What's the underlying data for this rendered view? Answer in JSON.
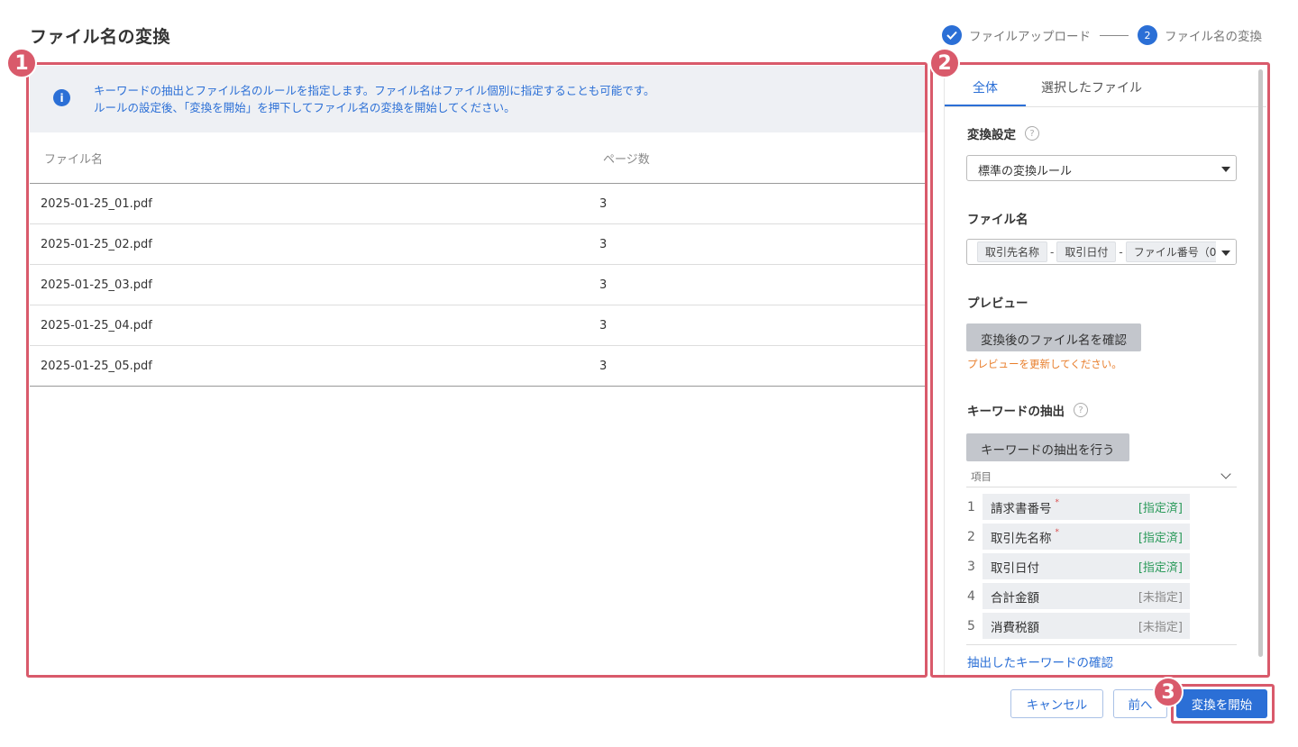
{
  "page_title": "ファイル名の変換",
  "stepper": {
    "step1_label": "ファイルアップロード",
    "step2_number": "2",
    "step2_label": "ファイル名の変換"
  },
  "annotations": [
    "1",
    "2",
    "3"
  ],
  "info": {
    "line1": "キーワードの抽出とファイル名のルールを指定します。ファイル名はファイル個別に指定することも可能です。",
    "line2": "ルールの設定後、「変換を開始」を押下してファイル名の変換を開始してください。"
  },
  "table": {
    "headers": {
      "name": "ファイル名",
      "pages": "ページ数"
    },
    "rows": [
      {
        "name": "2025-01-25_01.pdf",
        "pages": "3"
      },
      {
        "name": "2025-01-25_02.pdf",
        "pages": "3"
      },
      {
        "name": "2025-01-25_03.pdf",
        "pages": "3"
      },
      {
        "name": "2025-01-25_04.pdf",
        "pages": "3"
      },
      {
        "name": "2025-01-25_05.pdf",
        "pages": "3"
      }
    ]
  },
  "right": {
    "tabs": {
      "all": "全体",
      "selected": "選択したファイル"
    },
    "conversion_settings_label": "変換設定",
    "conversion_rule_value": "標準の変換ルール",
    "filename_label": "ファイル名",
    "filename_chips": [
      "取引先名称",
      "取引日付",
      "ファイル番号（0"
    ],
    "separator": "-",
    "preview_label": "プレビュー",
    "preview_button": "変換後のファイル名を確認",
    "preview_warning": "プレビューを更新してください。",
    "keyword_label": "キーワードの抽出",
    "keyword_button": "キーワードの抽出を行う",
    "keyword_header": "項目",
    "keywords": [
      {
        "num": "1",
        "label": "請求書番号",
        "required": "*",
        "status": "[指定済]"
      },
      {
        "num": "2",
        "label": "取引先名称",
        "required": "*",
        "status": "[指定済]"
      },
      {
        "num": "3",
        "label": "取引日付",
        "required": "",
        "status": "[指定済]"
      },
      {
        "num": "4",
        "label": "合計金額",
        "required": "",
        "status": "[未指定]"
      },
      {
        "num": "5",
        "label": "消費税額",
        "required": "",
        "status": "[未指定]"
      }
    ],
    "keyword_link": "抽出したキーワードの確認",
    "help_glyph": "?"
  },
  "footer": {
    "cancel": "キャンセル",
    "prev": "前へ",
    "start": "変換を開始"
  },
  "colors": {
    "accent": "#2b6fd6",
    "annotation": "#d95a6b",
    "warning": "#e87d2a",
    "set_status": "#2a9a5a"
  }
}
